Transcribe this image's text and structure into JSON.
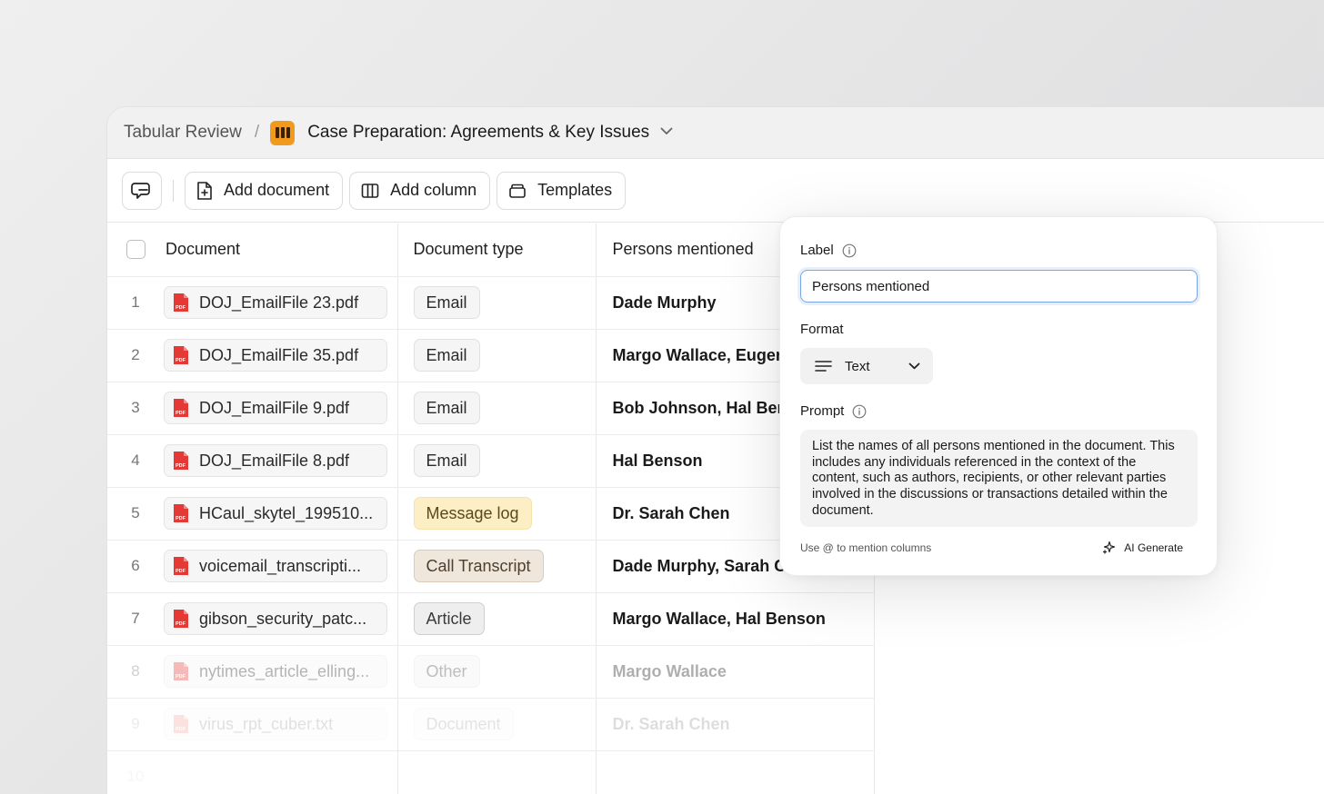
{
  "breadcrumb": {
    "root": "Tabular Review",
    "separator": "/",
    "title": "Case Preparation: Agreements & Key Issues"
  },
  "toolbar": {
    "add_document": "Add document",
    "add_column": "Add column",
    "templates": "Templates"
  },
  "table": {
    "headers": {
      "document": "Document",
      "document_type": "Document type",
      "persons": "Persons mentioned"
    },
    "rows": [
      {
        "n": "1",
        "file": "DOJ_EmailFile 23.pdf",
        "type": "Email",
        "persons": "Dade Murphy"
      },
      {
        "n": "2",
        "file": "DOJ_EmailFile 35.pdf",
        "type": "Email",
        "persons": "Margo Wallace, Euger"
      },
      {
        "n": "3",
        "file": "DOJ_EmailFile 9.pdf",
        "type": "Email",
        "persons": "Bob Johnson, Hal Ben"
      },
      {
        "n": "4",
        "file": "DOJ_EmailFile 8.pdf",
        "type": "Email",
        "persons": "Hal Benson"
      },
      {
        "n": "5",
        "file": "HCaul_skytel_199510...",
        "type": "Message log",
        "persons": "Dr. Sarah Chen"
      },
      {
        "n": "6",
        "file": "voicemail_transcripti...",
        "type": "Call Transcript",
        "persons": "Dade Murphy, Sarah C."
      },
      {
        "n": "7",
        "file": "gibson_security_patc...",
        "type": "Article",
        "persons": "Margo Wallace, Hal Benson"
      },
      {
        "n": "8",
        "file": "nytimes_article_elling...",
        "type": "Other",
        "persons": "Margo Wallace"
      },
      {
        "n": "9",
        "file": "virus_rpt_cuber.txt",
        "type": "Document",
        "persons": "Dr. Sarah Chen"
      },
      {
        "n": "10",
        "file": "",
        "type": "",
        "persons": ""
      }
    ]
  },
  "type_colors": {
    "Email": {
      "bg": "#f5f5f5",
      "border": "#e1e1e1",
      "fg": "#2a2a2a"
    },
    "Message log": {
      "bg": "#fcefc6",
      "border": "#f5e2a6",
      "fg": "#5a4a1a"
    },
    "Call Transcript": {
      "bg": "#efe6dc",
      "border": "#dccbb8",
      "fg": "#4f3e2c"
    },
    "Article": {
      "bg": "#eeeeee",
      "border": "#cfcfcf",
      "fg": "#3a3a3a"
    },
    "Other": {
      "bg": "#f2f2f2",
      "border": "#dedede",
      "fg": "#444"
    },
    "Document": {
      "bg": "#f2f2f2",
      "border": "#dedede",
      "fg": "#444"
    }
  },
  "column_editor": {
    "label_heading": "Label",
    "label_value": "Persons mentioned",
    "format_heading": "Format",
    "format_value": "Text",
    "prompt_heading": "Prompt",
    "prompt_text": "List the names of all persons mentioned in the document. This includes any individuals referenced in the context of the content, such as authors, recipients, or other relevant parties involved in the discussions or transactions detailed within the document.",
    "hint": "Use @ to mention columns",
    "ai_generate": "AI Generate"
  },
  "colors": {
    "accent_orange": "#f29a1e",
    "pdf_red": "#e53935",
    "focus_blue": "#7aa5e6"
  }
}
